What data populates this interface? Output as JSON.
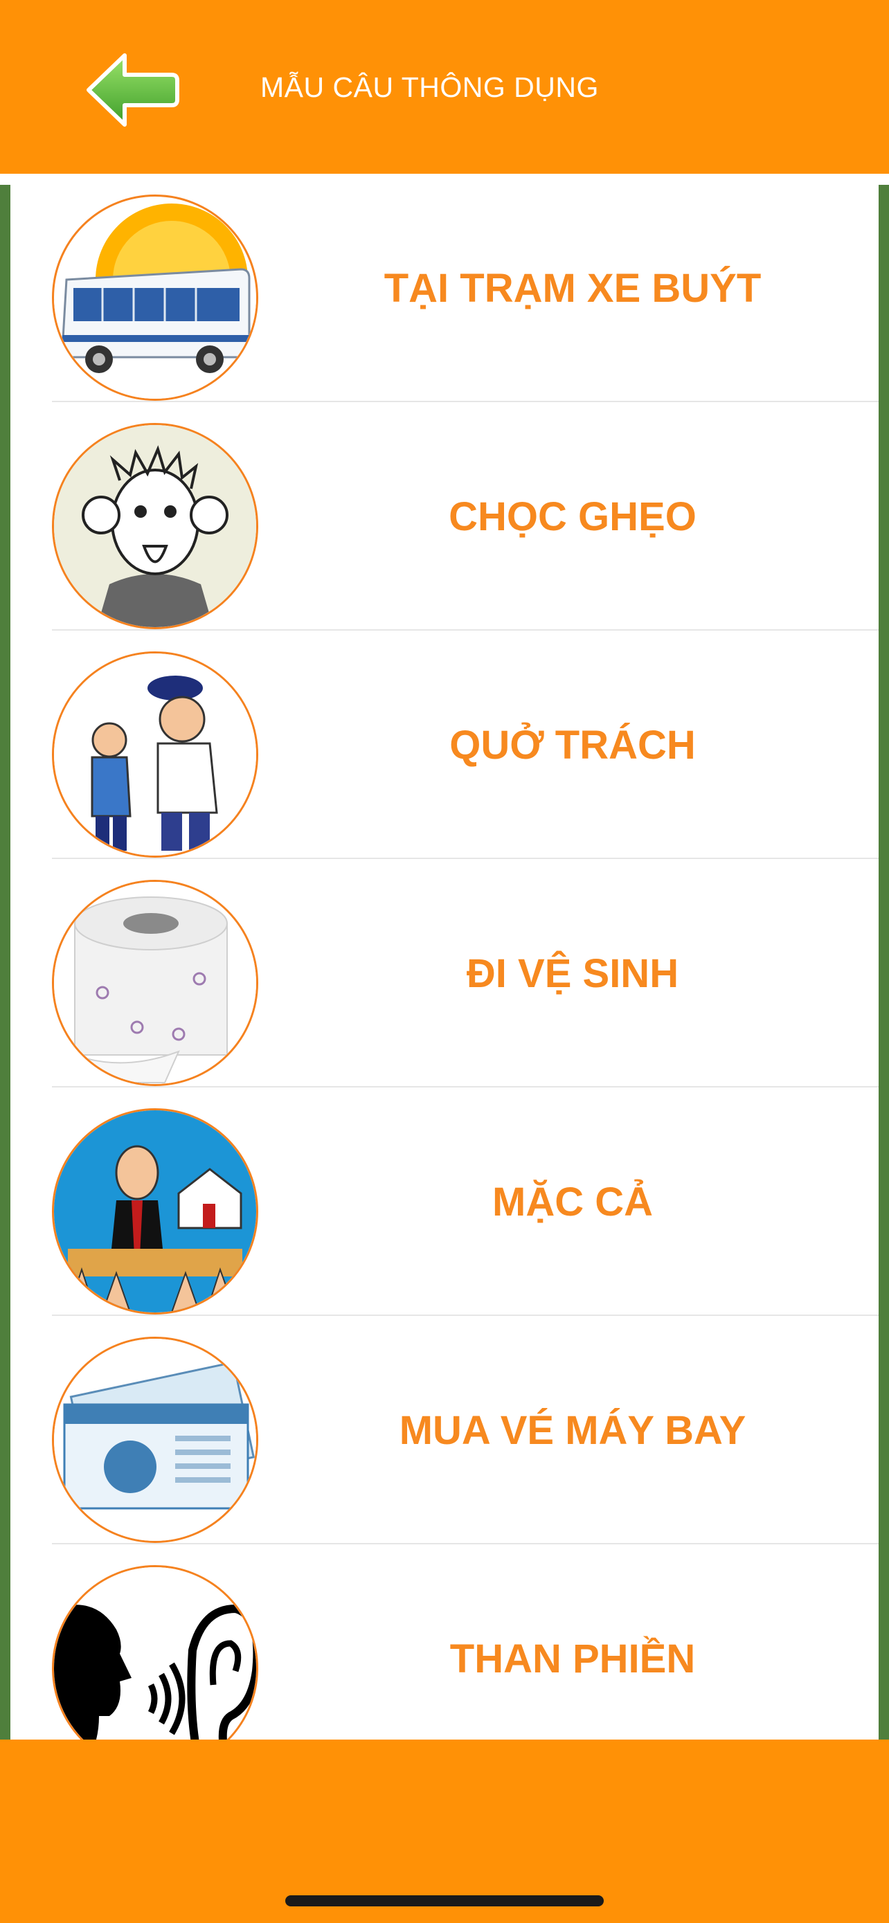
{
  "header": {
    "title": "MẪU CÂU THÔNG DỤNG",
    "back_icon": "arrow-left-icon",
    "color": "#FF9106"
  },
  "list": {
    "items": [
      {
        "label": "TẠI TRẠM XE BUÝT",
        "icon": "bus-icon"
      },
      {
        "label": "CHỌC GHẸO",
        "icon": "teasing-face-icon"
      },
      {
        "label": "QUỞ TRÁCH",
        "icon": "scolding-guard-icon"
      },
      {
        "label": "ĐI VỆ SINH",
        "icon": "toilet-paper-icon"
      },
      {
        "label": "MẶC CẢ",
        "icon": "auction-house-icon"
      },
      {
        "label": "MUA VÉ MÁY BAY",
        "icon": "boarding-pass-icon"
      },
      {
        "label": "THAN PHIỀN",
        "icon": "speaking-listening-icon"
      }
    ],
    "text_color": "#F7891F",
    "border_color": "#4F7F3C"
  }
}
